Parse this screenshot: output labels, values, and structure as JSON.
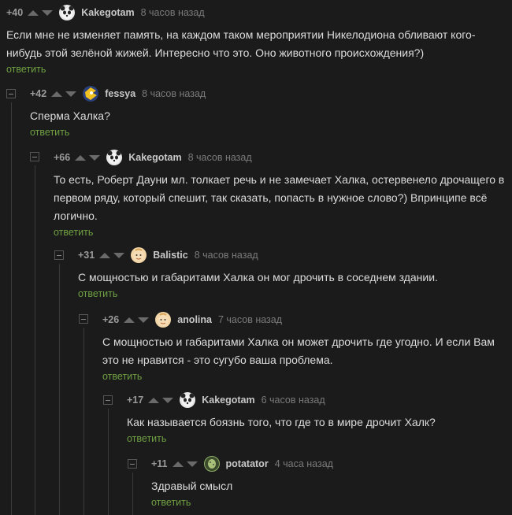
{
  "comments": [
    {
      "rating": "+40",
      "user": "Kakegotam",
      "time": "8 часов назад",
      "text": "Если мне не изменяет память, на каждом таком мероприятии Никелодиона обливают кого-нибудь этой зелёной жижей. Интересно что это. Оно животного происхождения?)",
      "reply": "ответить"
    },
    {
      "rating": "+42",
      "user": "fessya",
      "time": "8 часов назад",
      "text": "Сперма Халка?",
      "reply": "ответить"
    },
    {
      "rating": "+66",
      "user": "Kakegotam",
      "time": "8 часов назад",
      "text": "То есть, Роберт Дауни мл. толкает речь и не замечает Халка, остервенело дрочащего в первом ряду, который спешит, так сказать, попасть в нужное слово?) Впринципе всё логично.",
      "reply": "ответить"
    },
    {
      "rating": "+31",
      "user": "Balistic",
      "time": "8 часов назад",
      "text": "С мощностью и габаритами Халка он мог дрочить в соседнем здании.",
      "reply": "ответить"
    },
    {
      "rating": "+26",
      "user": "anolina",
      "time": "7 часов назад",
      "text": "С мощностью и габаритами Халка он может дрочить где угодно. И если Вам это не нравится - это сугубо ваша проблема.",
      "reply": "ответить"
    },
    {
      "rating": "+17",
      "user": "Kakegotam",
      "time": "6 часов назад",
      "text": "Как называется боязнь того, что где то в мире дрочит Халк?",
      "reply": "ответить"
    },
    {
      "rating": "+11",
      "user": "potatator",
      "time": "4 часа назад",
      "text": "Здравый смысл",
      "reply": "ответить"
    }
  ],
  "avatars": [
    "panda-avatar",
    "sonic-avatar",
    "panda-avatar",
    "baby-avatar",
    "baby-avatar",
    "panda-avatar",
    "potato-avatar"
  ],
  "colors": {
    "background": "#1b1b1b",
    "reply": "#6fa042",
    "text": "#dcdcdc",
    "meta": "#7a7a7a"
  }
}
